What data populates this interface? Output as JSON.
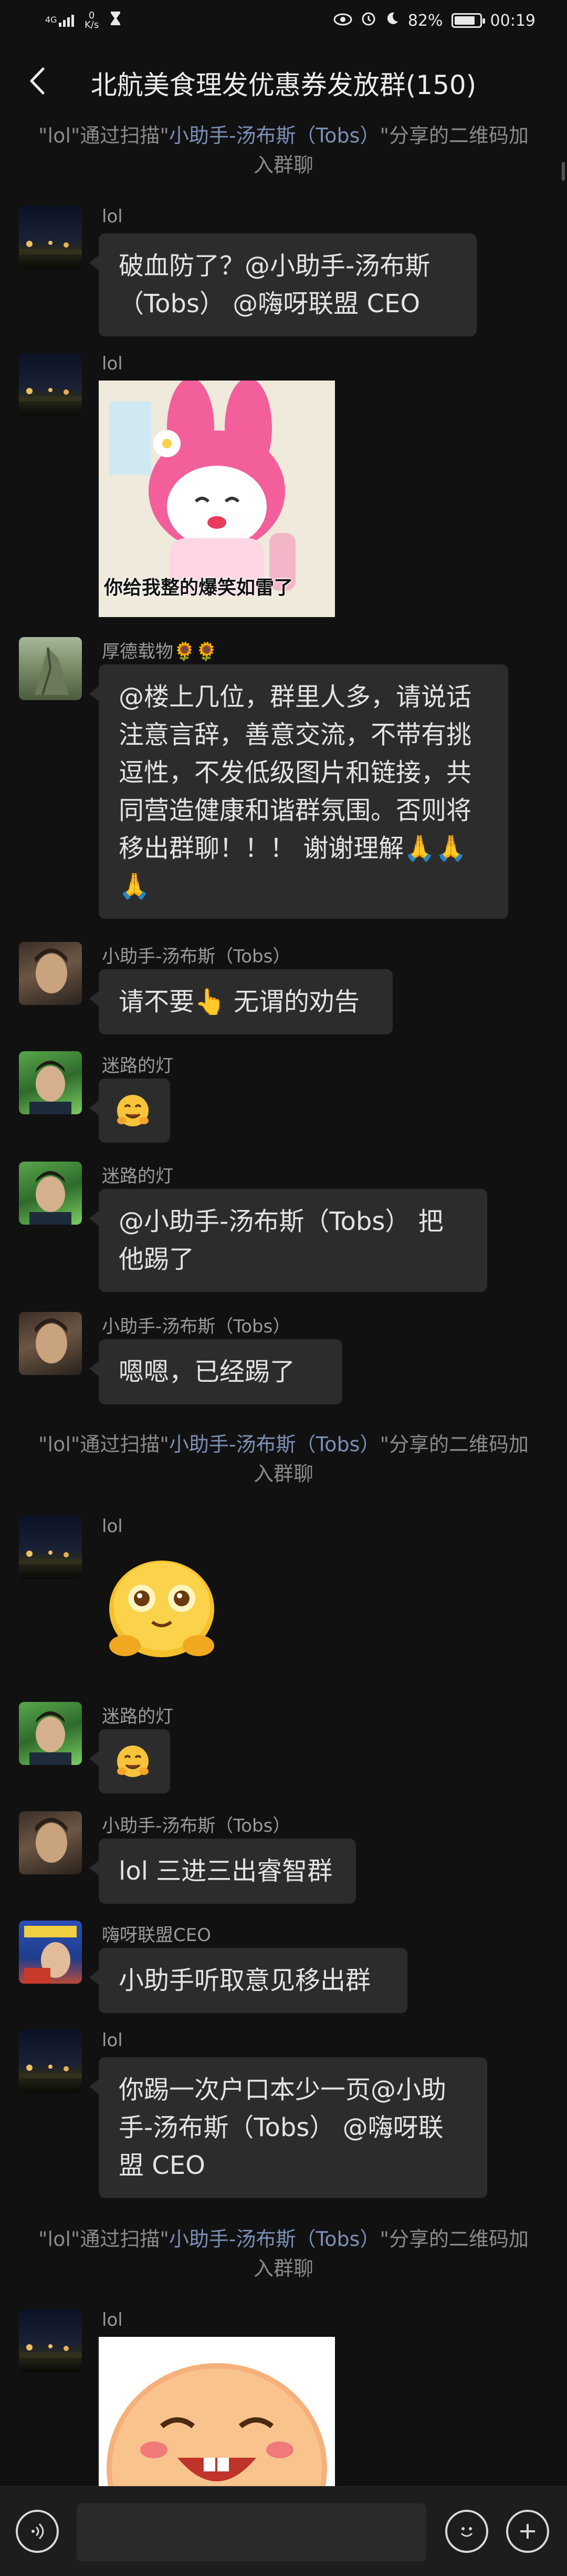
{
  "status_bar": {
    "signal": "4G",
    "net_speed_value": "0",
    "net_speed_unit": "K/s",
    "battery": "82%",
    "battery_level": 0.82,
    "time": "00:19"
  },
  "header": {
    "title": "北航美食理发优惠券发放群(150)"
  },
  "system_messages": [
    {
      "prefix": "\"lol\"通过扫描\"",
      "link": "小助手-汤布斯（Tobs）",
      "suffix": "\"分享的二维码加入群聊"
    },
    {
      "prefix": "\"lol\"通过扫描\"",
      "link": "小助手-汤布斯（Tobs）",
      "suffix": "\"分享的二维码加入群聊"
    },
    {
      "prefix": "\"lol\"通过扫描\"",
      "link": "小助手-汤布斯（Tobs）",
      "suffix": "\"分享的二维码加入群聊"
    }
  ],
  "messages": [
    {
      "sender": "lol",
      "text": "破血防了？@小助手-汤布斯（Tobs） @嗨呀联盟 CEO"
    },
    {
      "sender": "lol",
      "sticker_caption": "你给我整的爆笑如雷了"
    },
    {
      "sender": "厚德载物🌻🌻",
      "text": "@楼上几位，群里人多，请说话注意言辞，善意交流，不带有挑逗性，不发低级图片和链接，共同营造健康和谐群氛围。否则将移出群聊！！！ 谢谢理解🙏🙏🙏"
    },
    {
      "sender": "小助手-汤布斯（Tobs）",
      "text": "请不要👆 无谓的劝告"
    },
    {
      "sender": "迷路的灯",
      "emoji": "hugging-face"
    },
    {
      "sender": "迷路的灯",
      "text": "@小助手-汤布斯（Tobs） 把他踢了"
    },
    {
      "sender": "小助手-汤布斯（Tobs）",
      "text": "嗯嗯，已经踢了"
    },
    {
      "sender": "lol",
      "sticker": "yellow-blob-sticker"
    },
    {
      "sender": "迷路的灯",
      "emoji": "hugging-face"
    },
    {
      "sender": "小助手-汤布斯（Tobs）",
      "text": "lol 三进三出睿智群"
    },
    {
      "sender": "嗨呀联盟CEO",
      "text": "小助手听取意见移出群"
    },
    {
      "sender": "lol",
      "text": "你踢一次户口本少一页@小助手-汤布斯（Tobs） @嗨呀联盟 CEO"
    },
    {
      "sender": "lol",
      "sticker": "laughing-face-sticker"
    }
  ],
  "input_bar": {
    "placeholder": "",
    "voice_icon": "voice-icon",
    "emoji_icon": "emoji-icon",
    "plus_icon": "plus-icon"
  },
  "colors": {
    "background": "#111111",
    "bubble": "#2c2c2c",
    "link": "#7b8fb6",
    "system_text": "#8a8a8a"
  }
}
